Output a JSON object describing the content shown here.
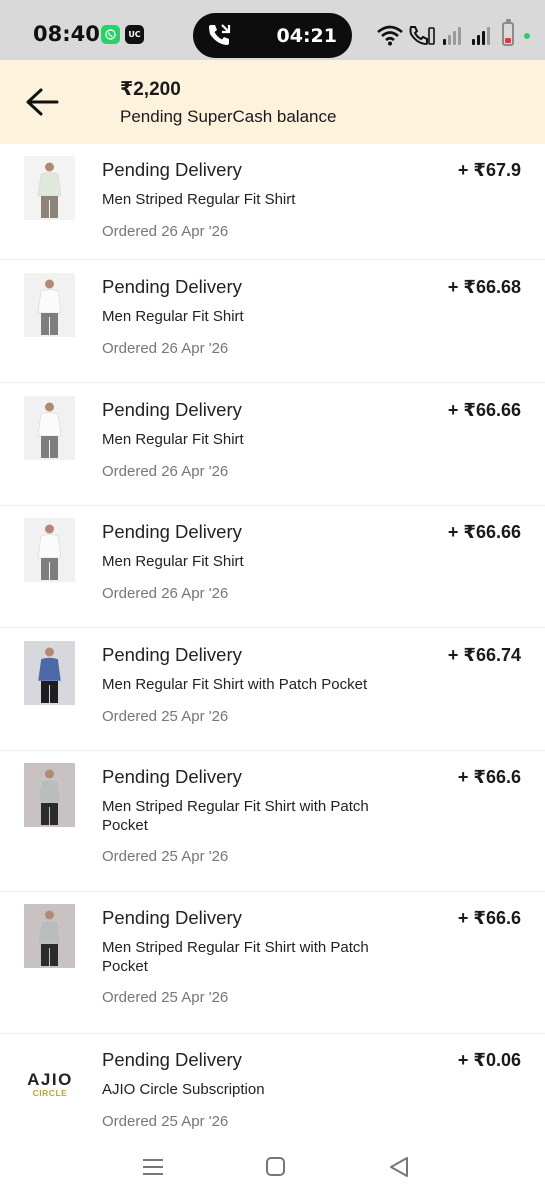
{
  "status_bar": {
    "time": "08:40",
    "wa_icon": "whatsapp-icon",
    "uc_label": "UC",
    "call_timer": "04:21",
    "battery_level": 0.15
  },
  "header": {
    "amount": "₹2,200",
    "label": "Pending SuperCash balance"
  },
  "items": [
    {
      "status": "Pending Delivery",
      "name": "Men Striped Regular Fit Shirt",
      "amount": "+ ₹67.9",
      "ordered": "Ordered 26 Apr '26",
      "thumb": "light-green-shirt"
    },
    {
      "status": "Pending Delivery",
      "name": "Men Regular Fit Shirt",
      "amount": "+ ₹66.68",
      "ordered": "Ordered 26 Apr '26",
      "thumb": "white-shirt"
    },
    {
      "status": "Pending Delivery",
      "name": "Men Regular Fit Shirt",
      "amount": "+ ₹66.66",
      "ordered": "Ordered 26 Apr '26",
      "thumb": "white-shirt"
    },
    {
      "status": "Pending Delivery",
      "name": "Men Regular Fit Shirt",
      "amount": "+ ₹66.66",
      "ordered": "Ordered 26 Apr '26",
      "thumb": "white-shirt"
    },
    {
      "status": "Pending Delivery",
      "name": "Men Regular Fit Shirt with Patch Pocket",
      "amount": "+ ₹66.74",
      "ordered": "Ordered 25 Apr '26",
      "thumb": "blue-shirt"
    },
    {
      "status": "Pending Delivery",
      "name": "Men Striped Regular Fit Shirt with Patch Pocket",
      "amount": "+ ₹66.6",
      "ordered": "Ordered 25 Apr '26",
      "thumb": "grey-shirt"
    },
    {
      "status": "Pending Delivery",
      "name": "Men Striped Regular Fit Shirt with Patch Pocket",
      "amount": "+ ₹66.6",
      "ordered": "Ordered 25 Apr '26",
      "thumb": "grey-shirt"
    },
    {
      "status": "Pending Delivery",
      "name": "AJIO Circle Subscription",
      "amount": "+ ₹0.06",
      "ordered": "Ordered 25 Apr '26",
      "thumb": "ajio-circle-logo",
      "logo_text": "AJIO",
      "logo_sub": "CIRCLE"
    }
  ],
  "navbar": {
    "icons": [
      "menu-icon",
      "home-square-icon",
      "back-triangle-icon"
    ]
  },
  "colors": {
    "header_bg": "#fdf3dc",
    "status_bg": "#d9d9d9",
    "date_text": "#777777"
  }
}
